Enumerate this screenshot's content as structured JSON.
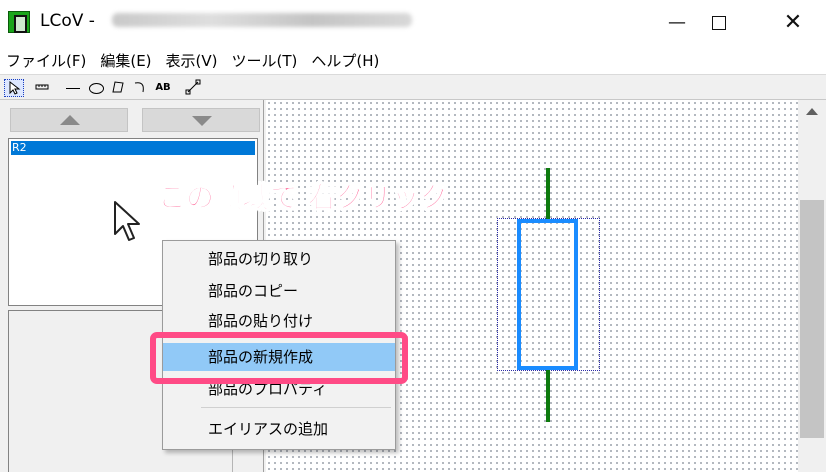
{
  "window": {
    "app_name": "LCoV -",
    "minimize_glyph": "—",
    "close_glyph": "✕"
  },
  "menu": {
    "items": [
      "ファイル(F)",
      "編集(E)",
      "表示(V)",
      "ツール(T)",
      "ヘルプ(H)"
    ]
  },
  "toolbar": {
    "icons": [
      "select-tool-icon",
      "ruler-icon",
      "line-tool-icon",
      "ellipse-tool-icon",
      "polygon-tool-icon",
      "arc-tool-icon",
      "text-tool-icon",
      "diagonal-line-icon"
    ],
    "text_tool_label": "AB"
  },
  "parts_panel": {
    "list_items": [
      "R2"
    ]
  },
  "annotation": {
    "text": "この領域で 右クリック",
    "color": "#ff4b86"
  },
  "context_menu": {
    "items": [
      "部品の切り取り",
      "部品のコピー",
      "部品の貼り付け",
      "部品の新規作成",
      "部品のプロパティ",
      "エイリアスの追加"
    ],
    "highlighted_index": 3
  },
  "canvas": {
    "resistor_color": "#1a8cff",
    "lead_color": "#0d7a0d"
  }
}
